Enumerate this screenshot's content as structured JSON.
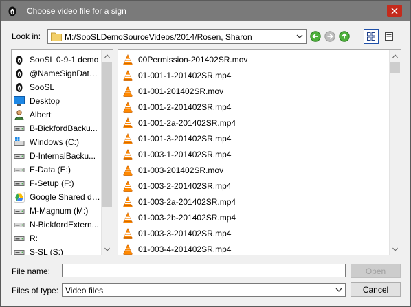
{
  "window": {
    "title": "Choose video file for a sign",
    "title_bar_color": "#7a7a7a",
    "close_color": "#c42b1c"
  },
  "lookin": {
    "label": "Look in:",
    "path": "M:/SooSLDemoSourceVideos/2014/Rosen, Sharon"
  },
  "toolbar": {
    "back_icon": "back-arrow-icon",
    "forward_icon": "forward-arrow-icon",
    "up_icon": "up-arrow-icon",
    "detail_view_icon": "list-view-icon",
    "detail_view_alt_icon": "detail-view-icon"
  },
  "places": [
    {
      "label": "SooSL 0-9-1 demo",
      "icon": "soosl-icon"
    },
    {
      "label": "@NameSignDatab...",
      "icon": "soosl-icon"
    },
    {
      "label": "SooSL",
      "icon": "soosl-icon"
    },
    {
      "label": "Desktop",
      "icon": "desktop-icon"
    },
    {
      "label": "Albert",
      "icon": "user-icon"
    },
    {
      "label": "B-BickfordBacku...",
      "icon": "drive-icon"
    },
    {
      "label": "Windows (C:)",
      "icon": "windows-drive-icon"
    },
    {
      "label": "D-InternalBacku...",
      "icon": "drive-icon"
    },
    {
      "label": "E-Data (E:)",
      "icon": "drive-icon"
    },
    {
      "label": "F-Setup (F:)",
      "icon": "drive-icon"
    },
    {
      "label": "Google Shared dr...",
      "icon": "google-drive-icon"
    },
    {
      "label": "M-Magnum (M:)",
      "icon": "drive-icon"
    },
    {
      "label": "N-BickfordExtern...",
      "icon": "drive-icon"
    },
    {
      "label": "R:",
      "icon": "drive-icon"
    },
    {
      "label": "S-SL (S:)",
      "icon": "drive-icon"
    }
  ],
  "files": [
    {
      "name": "00Permission-201402SR.mov"
    },
    {
      "name": "01-001-1-201402SR.mp4"
    },
    {
      "name": "01-001-201402SR.mov"
    },
    {
      "name": "01-001-2-201402SR.mp4"
    },
    {
      "name": "01-001-2a-201402SR.mp4"
    },
    {
      "name": "01-001-3-201402SR.mp4"
    },
    {
      "name": "01-003-1-201402SR.mp4"
    },
    {
      "name": "01-003-201402SR.mov"
    },
    {
      "name": "01-003-2-201402SR.mp4"
    },
    {
      "name": "01-003-2a-201402SR.mp4"
    },
    {
      "name": "01-003-2b-201402SR.mp4"
    },
    {
      "name": "01-003-3-201402SR.mp4"
    },
    {
      "name": "01-003-4-201402SR.mp4"
    }
  ],
  "filename": {
    "label": "File name:",
    "value": ""
  },
  "filetype": {
    "label": "Files of type:",
    "value": "Video files"
  },
  "buttons": {
    "open": "Open",
    "cancel": "Cancel"
  }
}
